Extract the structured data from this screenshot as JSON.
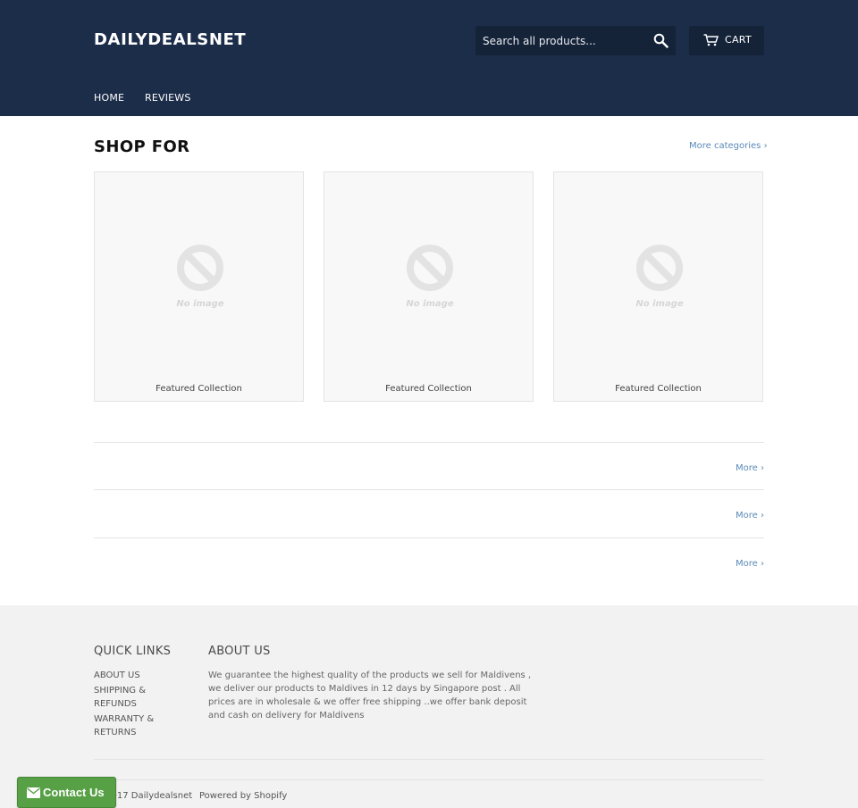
{
  "header": {
    "logo": "DAILYDEALSNET",
    "search": {
      "placeholder": "Search all products...",
      "icon": "search-icon"
    },
    "cart": {
      "label": "CART",
      "icon": "cart-icon"
    },
    "nav": [
      "HOME",
      "REVIEWS"
    ]
  },
  "colors": {
    "header_bg": "#1c2d4a",
    "link": "#5a8ab8",
    "footer_bg": "#f2f2f2",
    "contact_button": "#57a045"
  },
  "shop": {
    "title": "SHOP FOR",
    "more_categories": "More categories ›",
    "cards": [
      {
        "label": "Featured Collection",
        "image": "No image"
      },
      {
        "label": "Featured Collection",
        "image": "No image"
      },
      {
        "label": "Featured Collection",
        "image": "No image"
      }
    ]
  },
  "sections": [
    {
      "more": "More ›"
    },
    {
      "more": "More ›"
    },
    {
      "more": "More ›"
    }
  ],
  "footer": {
    "quick_links_title": "QUICK LINKS",
    "quick_links": [
      "ABOUT US",
      "SHIPPING & REFUNDS",
      "WARRANTY & RETURNS"
    ],
    "about_title": "ABOUT US",
    "about_text": "We guarantee the highest quality of the products we sell for Maldivens , we deliver our products to Maldives  in 12  days by Singapore  post  . All prices are in wholesale & we offer free shipping   ..we offer bank deposit and cash on delivery for  Maldivens",
    "copyright": "© 2017 Dailydealsnet",
    "powered_by": "Powered by Shopify"
  },
  "contact_button": {
    "label": "Contact Us",
    "icon": "envelope-icon"
  }
}
